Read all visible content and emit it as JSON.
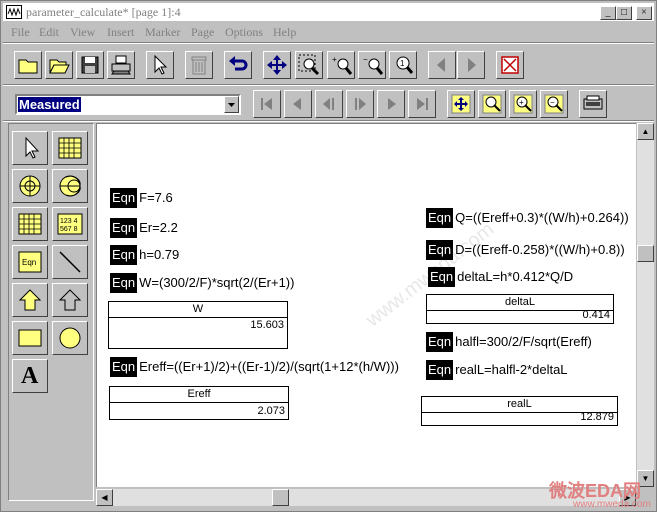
{
  "window": {
    "title": "parameter_calculate* [page 1]:4"
  },
  "titlebar_buttons": [
    "_",
    "□",
    "×"
  ],
  "menu": [
    "File",
    "Edit",
    "View",
    "Insert",
    "Marker",
    "Page",
    "Options",
    "Help"
  ],
  "measure_select": {
    "value": "Measured"
  },
  "toolbar1_icons": [
    "folder-icon",
    "open-icon",
    "save-icon",
    "print-icon",
    "pointer-icon",
    "trash-icon",
    "undo-icon",
    "move-icon",
    "zoom-area-icon",
    "zoom-in-icon",
    "zoom-out-icon",
    "zoom-one-icon",
    "prev-page-icon",
    "next-page-icon",
    "close-page-icon"
  ],
  "palette_icons": [
    "pointer-tool-icon",
    "table-tool-icon",
    "polar-plot-icon",
    "smith-chart-icon",
    "grid-tool-icon",
    "list-tool-icon",
    "eqn-tool-icon",
    "line-tool-icon",
    "arrow-up-icon",
    "arrow-up-outline-icon",
    "rectangle-tool-icon",
    "circle-tool-icon",
    "text-tool-icon"
  ],
  "palette_labels": {
    "list": "123 4\n567 8",
    "eqn": "Eqn",
    "text": "A"
  },
  "eqn_tag": "Eqn",
  "equations_left": [
    {
      "expr": "F=7.6"
    },
    {
      "expr": "Er=2.2"
    },
    {
      "expr": "h=0.79"
    },
    {
      "expr": "W=(300/2/F)*sqrt(2/(Er+1))"
    },
    {
      "expr": "Ereff=((Er+1)/2)+((Er-1)/2)/(sqrt(1+12*(h/W)))"
    }
  ],
  "equations_right": [
    {
      "expr": "Q=((Ereff+0.3)*((W/h)+0.264))"
    },
    {
      "expr": "D=((Ereff-0.258)*((W/h)+0.8))"
    },
    {
      "expr": "deltaL=h*0.412*Q/D"
    },
    {
      "expr": "halfl=300/2/F/sqrt(Ereff)"
    },
    {
      "expr": "realL=halfl-2*deltaL"
    }
  ],
  "results": {
    "W": {
      "label": "W",
      "value": "15.603"
    },
    "Ereff": {
      "label": "Ereff",
      "value": "2.073"
    },
    "deltaL": {
      "label": "deltaL",
      "value": "0.414"
    },
    "realL": {
      "label": "realL",
      "value": "12.879"
    }
  },
  "watermark": "www.mweda.com",
  "brand": {
    "name": "微波EDA网",
    "url": "www.mweda.com"
  }
}
